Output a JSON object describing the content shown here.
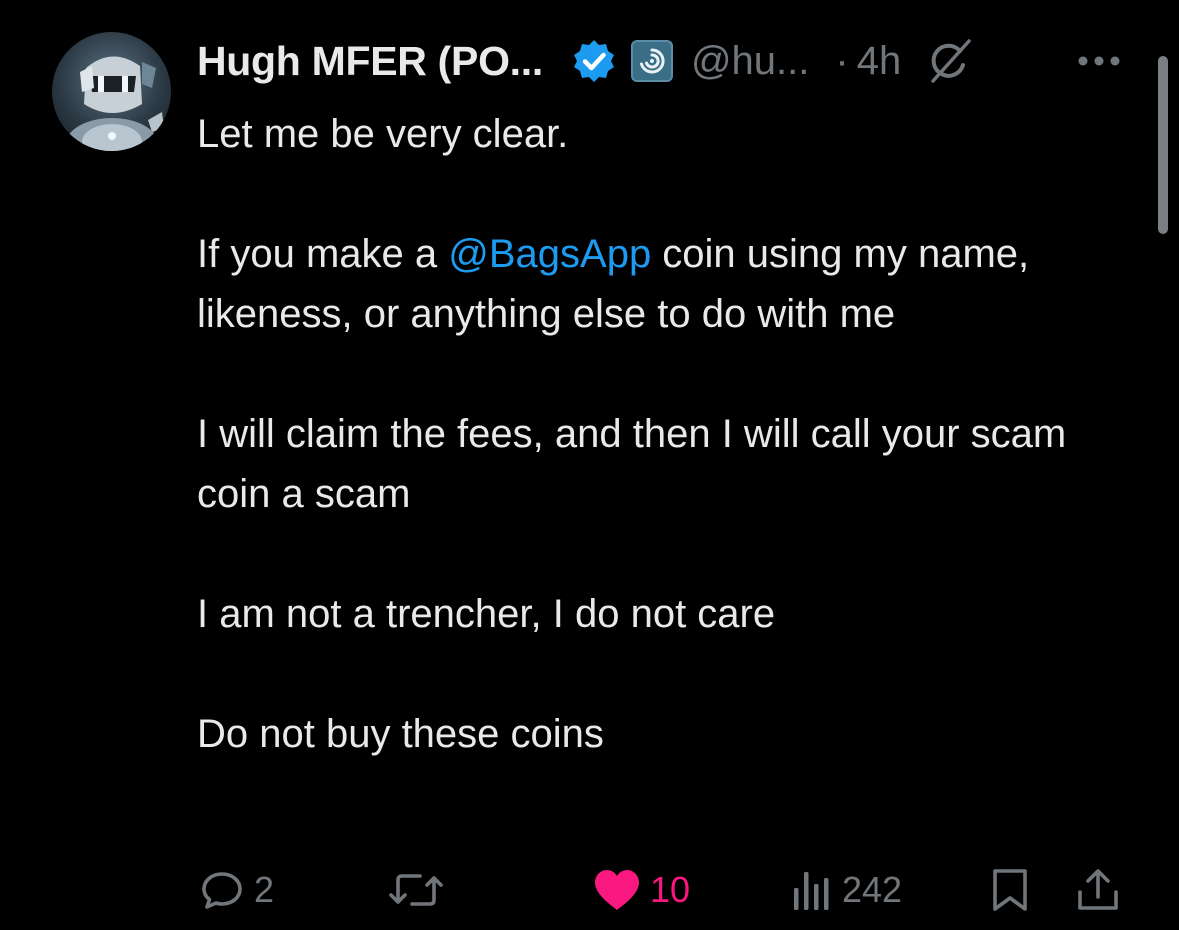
{
  "tweet": {
    "display_name": "Hugh MFER (PO...",
    "handle": "@hu...",
    "dot": "·",
    "time": "4h",
    "paragraphs": {
      "p1": "Let me be very clear.",
      "p2_before": "If you make a ",
      "p2_mention": "@BagsApp",
      "p2_after": " coin using my name, likeness, or anything else to do with me",
      "p3": "I will claim the fees, and then I will call your scam coin a scam",
      "p4": "I am not a trencher, I do not care",
      "p5": "Do not buy these coins"
    }
  },
  "actions": {
    "replies": "2",
    "reposts": "",
    "likes": "10",
    "views": "242"
  },
  "icons": {
    "verified": "verified-badge-icon",
    "affiliate": "affiliate-badge-icon",
    "grok": "grok-icon",
    "more": "more-icon",
    "reply": "reply-icon",
    "repost": "repost-icon",
    "like": "like-icon",
    "views": "views-icon",
    "bookmark": "bookmark-icon",
    "share": "share-icon"
  },
  "colors": {
    "background": "#000000",
    "text": "#e7e9ea",
    "muted": "#71767b",
    "link": "#1d9bf0",
    "like": "#f91880"
  }
}
